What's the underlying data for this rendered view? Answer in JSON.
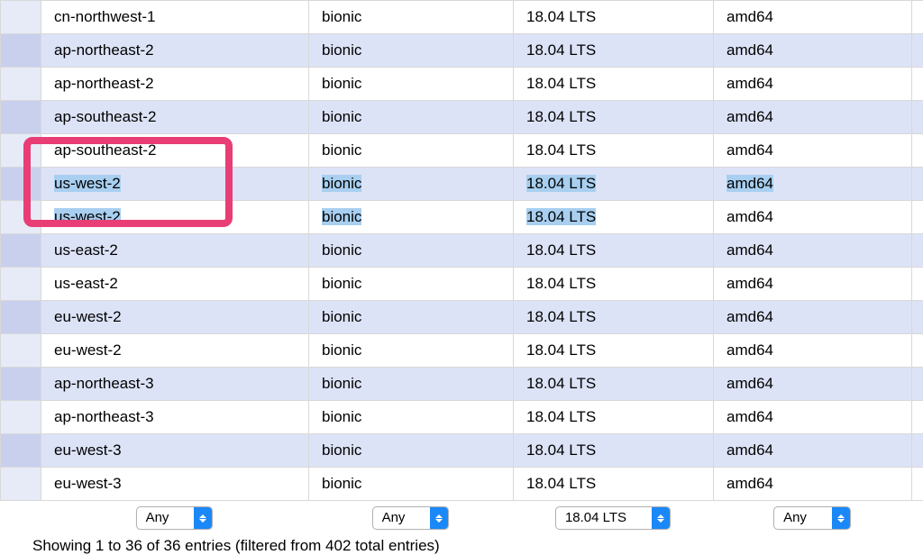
{
  "rows": [
    {
      "region": "cn-northwest-1",
      "name": "bionic",
      "version": "18.04 LTS",
      "arch": "amd64",
      "rowclass": "even",
      "hl_region": false,
      "hl_name": false,
      "hl_version": false,
      "hl_arch": false
    },
    {
      "region": "ap-northeast-2",
      "name": "bionic",
      "version": "18.04 LTS",
      "arch": "amd64",
      "rowclass": "odd",
      "hl_region": false,
      "hl_name": false,
      "hl_version": false,
      "hl_arch": false
    },
    {
      "region": "ap-northeast-2",
      "name": "bionic",
      "version": "18.04 LTS",
      "arch": "amd64",
      "rowclass": "even",
      "hl_region": false,
      "hl_name": false,
      "hl_version": false,
      "hl_arch": false
    },
    {
      "region": "ap-southeast-2",
      "name": "bionic",
      "version": "18.04 LTS",
      "arch": "amd64",
      "rowclass": "odd",
      "hl_region": false,
      "hl_name": false,
      "hl_version": false,
      "hl_arch": false
    },
    {
      "region": "ap-southeast-2",
      "name": "bionic",
      "version": "18.04 LTS",
      "arch": "amd64",
      "rowclass": "even",
      "hl_region": false,
      "hl_name": false,
      "hl_version": false,
      "hl_arch": false
    },
    {
      "region": "us-west-2",
      "name": "bionic",
      "version": "18.04 LTS",
      "arch": "amd64",
      "rowclass": "odd",
      "hl_region": true,
      "hl_name": true,
      "hl_version": true,
      "hl_arch": true
    },
    {
      "region": "us-west-2",
      "name": "bionic",
      "version": "18.04 LTS",
      "arch": "amd64",
      "rowclass": "even",
      "hl_region": true,
      "hl_name": true,
      "hl_version": true,
      "hl_arch": false
    },
    {
      "region": "us-east-2",
      "name": "bionic",
      "version": "18.04 LTS",
      "arch": "amd64",
      "rowclass": "odd",
      "hl_region": false,
      "hl_name": false,
      "hl_version": false,
      "hl_arch": false
    },
    {
      "region": "us-east-2",
      "name": "bionic",
      "version": "18.04 LTS",
      "arch": "amd64",
      "rowclass": "even",
      "hl_region": false,
      "hl_name": false,
      "hl_version": false,
      "hl_arch": false
    },
    {
      "region": "eu-west-2",
      "name": "bionic",
      "version": "18.04 LTS",
      "arch": "amd64",
      "rowclass": "odd",
      "hl_region": false,
      "hl_name": false,
      "hl_version": false,
      "hl_arch": false
    },
    {
      "region": "eu-west-2",
      "name": "bionic",
      "version": "18.04 LTS",
      "arch": "amd64",
      "rowclass": "even",
      "hl_region": false,
      "hl_name": false,
      "hl_version": false,
      "hl_arch": false
    },
    {
      "region": "ap-northeast-3",
      "name": "bionic",
      "version": "18.04 LTS",
      "arch": "amd64",
      "rowclass": "odd",
      "hl_region": false,
      "hl_name": false,
      "hl_version": false,
      "hl_arch": false
    },
    {
      "region": "ap-northeast-3",
      "name": "bionic",
      "version": "18.04 LTS",
      "arch": "amd64",
      "rowclass": "even",
      "hl_region": false,
      "hl_name": false,
      "hl_version": false,
      "hl_arch": false
    },
    {
      "region": "eu-west-3",
      "name": "bionic",
      "version": "18.04 LTS",
      "arch": "amd64",
      "rowclass": "odd",
      "hl_region": false,
      "hl_name": false,
      "hl_version": false,
      "hl_arch": false
    },
    {
      "region": "eu-west-3",
      "name": "bionic",
      "version": "18.04 LTS",
      "arch": "amd64",
      "rowclass": "even",
      "hl_region": false,
      "hl_name": false,
      "hl_version": false,
      "hl_arch": false
    }
  ],
  "filters": {
    "region": {
      "selected": "Any"
    },
    "name": {
      "selected": "Any"
    },
    "version": {
      "selected": "18.04 LTS"
    },
    "arch": {
      "selected": "Any"
    }
  },
  "status": "Showing 1 to 36 of 36 entries (filtered from 402 total entries)"
}
